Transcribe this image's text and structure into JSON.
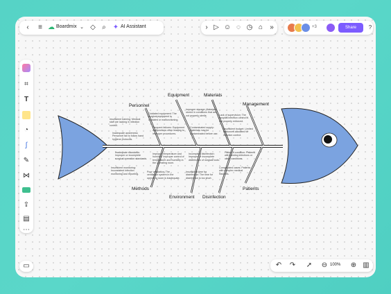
{
  "app": {
    "brand_name": "Boardmix",
    "ai_assistant_label": "AI Assistant",
    "share_label": "Share",
    "avatar_more": "+3",
    "zoom_level": "100%",
    "accent_color": "#7c5cff"
  },
  "diagram": {
    "categories": {
      "personnel": "Personnel",
      "equipment": "Equipment",
      "materials": "Materials",
      "management": "Management",
      "methods": "Methods",
      "environment": "Environment",
      "disinfection": "Disinfection",
      "patients": "Patients"
    },
    "notes": {
      "personnel_1": "Insufficient training: Medical staff are lacking in infection control.",
      "personnel_2": "Inadequate awareness: Personnel fail to follow hand hygiene protocols.",
      "equipment_1": "Outdated equipment: The surgical equipment is outdated or malfunctioning.",
      "equipment_2": "Frequent failures: Equipment malfunctions often leading to improper procedures.",
      "materials_1": "Improper storage: Materials stored in conditions that are not properly sterile.",
      "materials_2": "Contaminated supply: Materials may be contaminated before use.",
      "management_1": "Lack of supervision: The hospital infection control is not properly enforced.",
      "management_2": "Insufficient budget: Limited resources allocated for infection control.",
      "methods_1": "Inadequate standards: Improper or incomplete surgical operation standards.",
      "methods_2": "Insufficient monitoring: Inconsistent infection monitoring and reporting.",
      "environment_1": "Improper temperature and humidity: Improper control of temperature and humidity in the operating room.",
      "environment_2": "Poor ventilation: The ventilation system in the operating room is inadequate.",
      "disinfection_1": "Incomplete disinfection: Improper or incomplete disinfection of surgical tools.",
      "disinfection_2": "Insufficient time for disinfection: The time for disinfection is too short.",
      "patients_1": "Patient's condition: Patients with existing infections or other conditions.",
      "patients_2": "Complicated cases: Patients with complex medical histories."
    }
  }
}
